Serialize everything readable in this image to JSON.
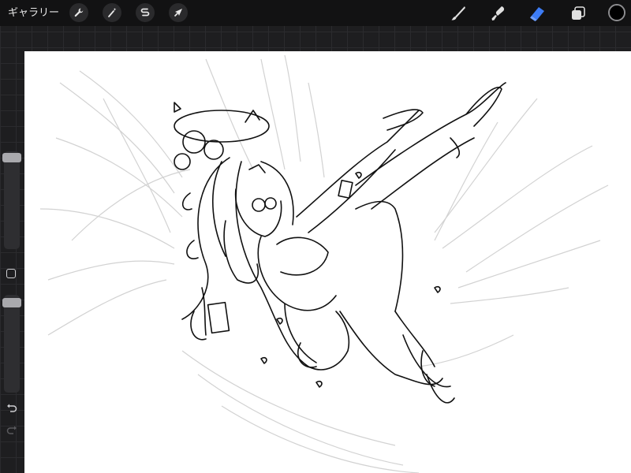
{
  "toolbar": {
    "gallery_label": "ギャラリー",
    "left_tools": [
      "wrench-icon",
      "magic-wand-icon",
      "selection-icon",
      "transform-arrow-icon"
    ],
    "right_tools": [
      "brush-icon",
      "smudge-icon",
      "eraser-icon",
      "layers-icon"
    ],
    "active_tool": "eraser",
    "active_color": "#000000",
    "accent": "#3d7cf5"
  },
  "sidebar": {
    "brush_size_level": 0.97,
    "opacity_level": 0.97,
    "icons": [
      "modify-square-icon",
      "undo-icon",
      "redo-icon"
    ]
  },
  "canvas": {
    "content": "line-art-sketch"
  }
}
